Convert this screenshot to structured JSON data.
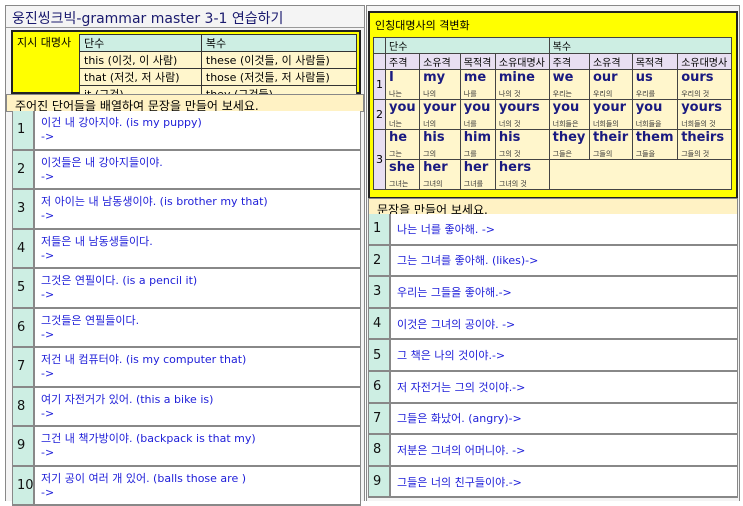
{
  "left": {
    "title": "웅진씽크빅-grammar master 3-1 연습하기",
    "demonstratives": {
      "label": "지시 대명사",
      "headers": [
        "단수",
        "복수"
      ],
      "rows": [
        [
          "this (이것, 이 사람)",
          "these (이것들, 이 사람들)"
        ],
        [
          "that (저것, 저 사람)",
          "those (저것들, 저 사람들)"
        ],
        [
          "it (그것)",
          "they (그것들)"
        ]
      ]
    },
    "instruction": "주어진 단어들을 배열하여 문장을 만들어 보세요.",
    "exercises": [
      {
        "num": "1",
        "text": "이건 내 강아지야. (is my puppy)",
        "answer": "->"
      },
      {
        "num": "2",
        "text": "이것들은 내 강아지들이야.",
        "answer": "->"
      },
      {
        "num": "3",
        "text": "저 아이는 내 남동생이야. (is brother my that)",
        "answer": "->"
      },
      {
        "num": "4",
        "text": "저들은 내 남동생들이다.",
        "answer": "->"
      },
      {
        "num": "5",
        "text": "그것은 연필이다. (is a pencil it)",
        "answer": "->"
      },
      {
        "num": "6",
        "text": "그것들은 연필들이다.",
        "answer": "->"
      },
      {
        "num": "7",
        "text": "저건 내 컴퓨터야. (is my computer that)",
        "answer": "->"
      },
      {
        "num": "8",
        "text": "여기 자전거가 있어. (this a bike is)",
        "answer": "->"
      },
      {
        "num": "9",
        "text": "그건 내 책가방이야. (backpack is that my)",
        "answer": "->"
      },
      {
        "num": "10",
        "text": "저기 공이 여러 개 있어. (balls those are )",
        "answer": "->"
      }
    ]
  },
  "right": {
    "title": "인칭대명사의 격변화",
    "group_headers": [
      "단수",
      "복수"
    ],
    "case_headers": [
      "주격",
      "소유격",
      "목적격",
      "소유대명사",
      "주격",
      "소유격",
      "목적격",
      "소유대명사"
    ],
    "rows": [
      {
        "num": "1",
        "cells": [
          [
            "I",
            "나는"
          ],
          [
            "my",
            "나의"
          ],
          [
            "me",
            "나를"
          ],
          [
            "mine",
            "나의 것"
          ],
          [
            "we",
            "우리는"
          ],
          [
            "our",
            "우리의"
          ],
          [
            "us",
            "우리를"
          ],
          [
            "ours",
            "우리의 것"
          ]
        ]
      },
      {
        "num": "2",
        "cells": [
          [
            "you",
            "너는"
          ],
          [
            "your",
            "너의"
          ],
          [
            "you",
            "너를"
          ],
          [
            "yours",
            "너의 것"
          ],
          [
            "you",
            "너희들은"
          ],
          [
            "your",
            "너희들의"
          ],
          [
            "you",
            "너희들을"
          ],
          [
            "yours",
            "너희들의 것"
          ]
        ]
      },
      {
        "num": "3",
        "cells": [
          [
            "he",
            "그는"
          ],
          [
            "his",
            "그의"
          ],
          [
            "him",
            "그를"
          ],
          [
            "his",
            "그의 것"
          ],
          [
            "they",
            "그들은"
          ],
          [
            "their",
            "그들의"
          ],
          [
            "them",
            "그들을"
          ],
          [
            "theirs",
            "그들의 것"
          ]
        ]
      },
      {
        "num": "",
        "cells": [
          [
            "she",
            "그녀는"
          ],
          [
            "her",
            "그녀의"
          ],
          [
            "her",
            "그녀를"
          ],
          [
            "hers",
            "그녀의 것"
          ]
        ]
      }
    ],
    "instruction": "문장을 만들어 보세요.",
    "exercises": [
      {
        "num": "1",
        "text": "나는 너를 좋아해. ->"
      },
      {
        "num": "2",
        "text": "그는 그녀를 좋아해. (likes)->"
      },
      {
        "num": "3",
        "text": "우리는 그들을 좋아해.->"
      },
      {
        "num": "4",
        "text": "이것은 그녀의 공이야. ->"
      },
      {
        "num": "5",
        "text": "그 책은 나의 것이야.->"
      },
      {
        "num": "6",
        "text": "저 자전거는 그의 것이야.->"
      },
      {
        "num": "7",
        "text": "그들은 화났어. (angry)->"
      },
      {
        "num": "8",
        "text": "저분은 그녀의 어머니야. ->"
      },
      {
        "num": "9",
        "text": "그들은 너의 친구들이야.->"
      }
    ]
  }
}
